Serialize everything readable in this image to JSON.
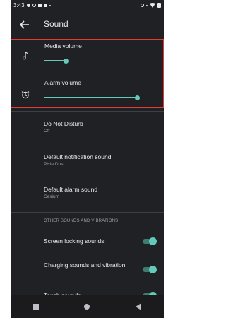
{
  "status_bar": {
    "time": "3:43"
  },
  "header": {
    "title": "Sound"
  },
  "volumes": [
    {
      "label": "Media volume",
      "icon": "music-note-icon",
      "level": 0.19
    },
    {
      "label": "Alarm volume",
      "icon": "alarm-clock-icon",
      "level": 0.82
    }
  ],
  "settings": [
    {
      "title": "Do Not Disturb",
      "subtitle": "Off"
    },
    {
      "title": "Default notification sound",
      "subtitle": "Pixie Dust"
    },
    {
      "title": "Default alarm sound",
      "subtitle": "Cesium"
    }
  ],
  "section_header": "OTHER SOUNDS AND VIBRATIONS",
  "toggles": [
    {
      "label": "Screen locking sounds",
      "on": true
    },
    {
      "label": "Charging sounds and vibration",
      "on": true
    },
    {
      "label": "Touch sounds",
      "on": true
    }
  ],
  "colors": {
    "accent": "#64c9b8",
    "background": "#202124",
    "highlight_border": "#e53935"
  }
}
